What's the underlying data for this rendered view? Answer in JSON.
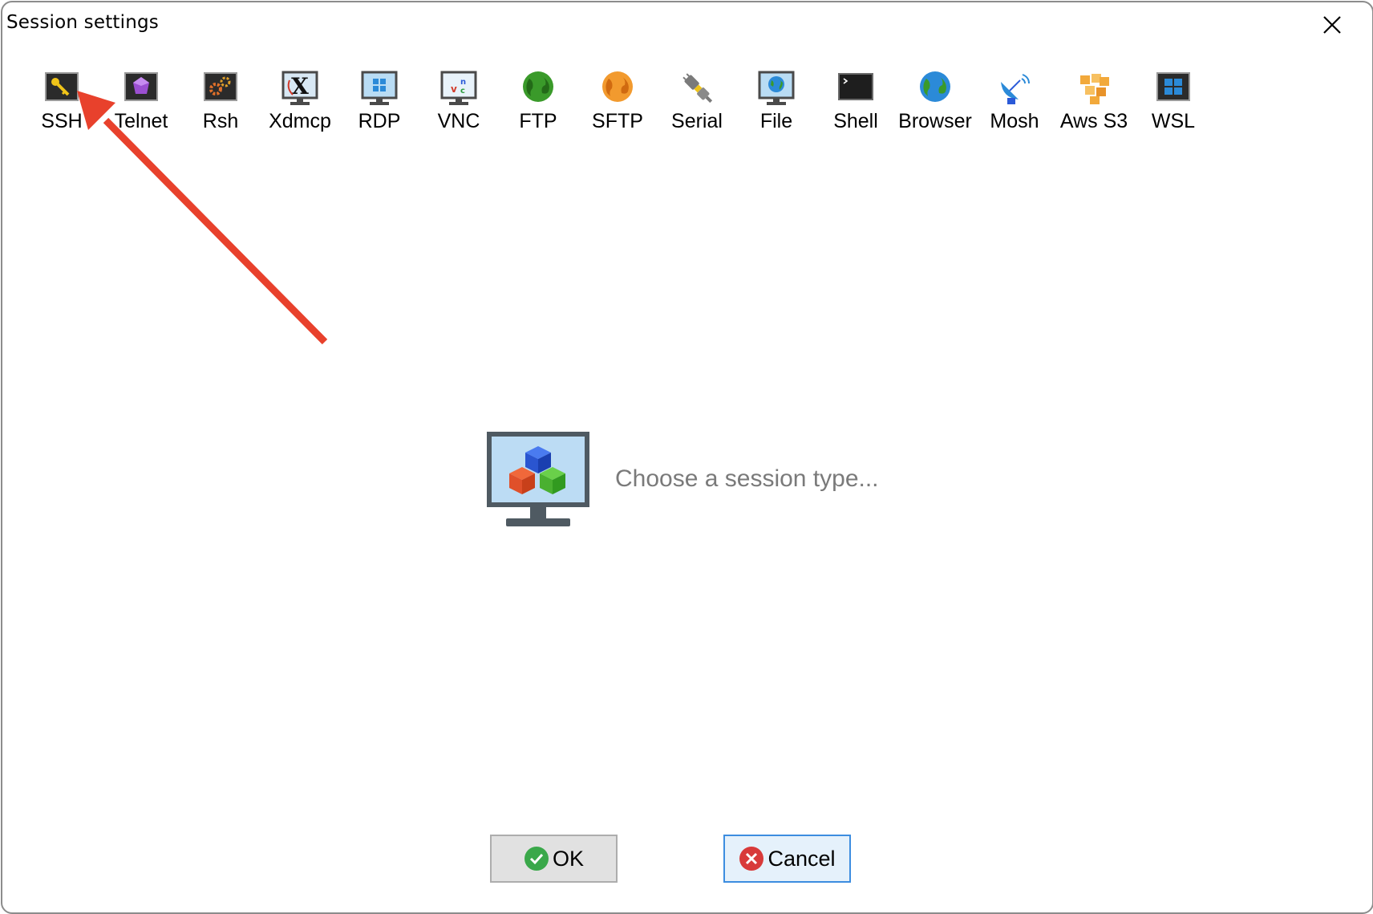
{
  "window": {
    "title": "Session settings"
  },
  "session_types": [
    {
      "label": "SSH",
      "icon": "key-icon"
    },
    {
      "label": "Telnet",
      "icon": "crystal-icon"
    },
    {
      "label": "Rsh",
      "icon": "gears-icon"
    },
    {
      "label": "Xdmcp",
      "icon": "x-monitor-icon"
    },
    {
      "label": "RDP",
      "icon": "windows-monitor-icon"
    },
    {
      "label": "VNC",
      "icon": "vnc-monitor-icon"
    },
    {
      "label": "FTP",
      "icon": "green-globe-icon"
    },
    {
      "label": "SFTP",
      "icon": "orange-globe-icon"
    },
    {
      "label": "Serial",
      "icon": "plug-icon"
    },
    {
      "label": "File",
      "icon": "globe-monitor-icon"
    },
    {
      "label": "Shell",
      "icon": "terminal-icon"
    },
    {
      "label": "Browser",
      "icon": "blue-globe-icon"
    },
    {
      "label": "Mosh",
      "icon": "satellite-dish-icon"
    },
    {
      "label": "Aws S3",
      "icon": "cubes-icon"
    },
    {
      "label": "WSL",
      "icon": "windows-logo-icon"
    }
  ],
  "main": {
    "prompt": "Choose a session type..."
  },
  "buttons": {
    "ok_label": "OK",
    "cancel_label": "Cancel"
  },
  "colors": {
    "annotation_arrow": "#e8412c",
    "cancel_border": "#3c8de0",
    "prompt_text": "#7a7a7a"
  }
}
